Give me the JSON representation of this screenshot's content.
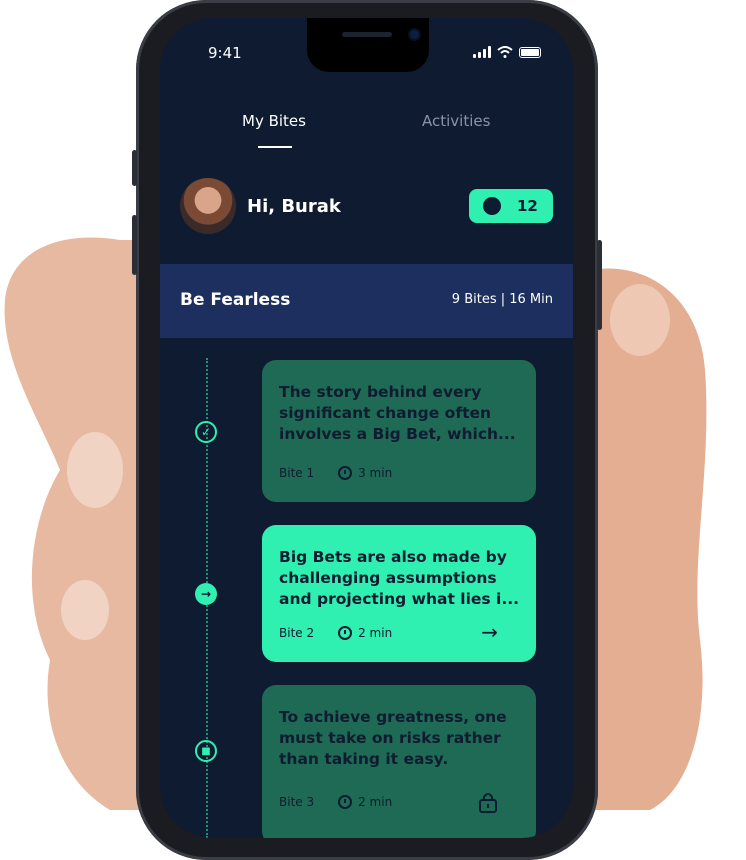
{
  "status_bar": {
    "time": "9:41"
  },
  "tabs": [
    {
      "label": "My Bites",
      "active": true
    },
    {
      "label": "Activities",
      "active": false
    }
  ],
  "greeting": {
    "text": "Hi, Burak",
    "points": "12"
  },
  "section": {
    "title": "Be Fearless",
    "meta": "9 Bites | 16 Min"
  },
  "bites": [
    {
      "text": "The story behind every significant change often involves a Big Bet, which...",
      "label": "Bite 1",
      "duration": "3 min",
      "status": "completed",
      "node_icon": "check-icon"
    },
    {
      "text": "Big Bets are also made by challenging assumptions and projecting what lies i...",
      "label": "Bite 2",
      "duration": "2 min",
      "status": "current",
      "node_icon": "arrow-right-icon",
      "action_icon": "arrow-right-icon"
    },
    {
      "text": "To achieve greatness, one must take on risks rather than taking it easy.",
      "label": "Bite 3",
      "duration": "2 min",
      "status": "locked",
      "node_icon": "lock-icon",
      "action_icon": "lock-icon"
    }
  ],
  "colors": {
    "background": "#0f1b30",
    "accent": "#2ff0b1",
    "section": "#1c2f5f",
    "muted_card": "#1e6a55"
  }
}
